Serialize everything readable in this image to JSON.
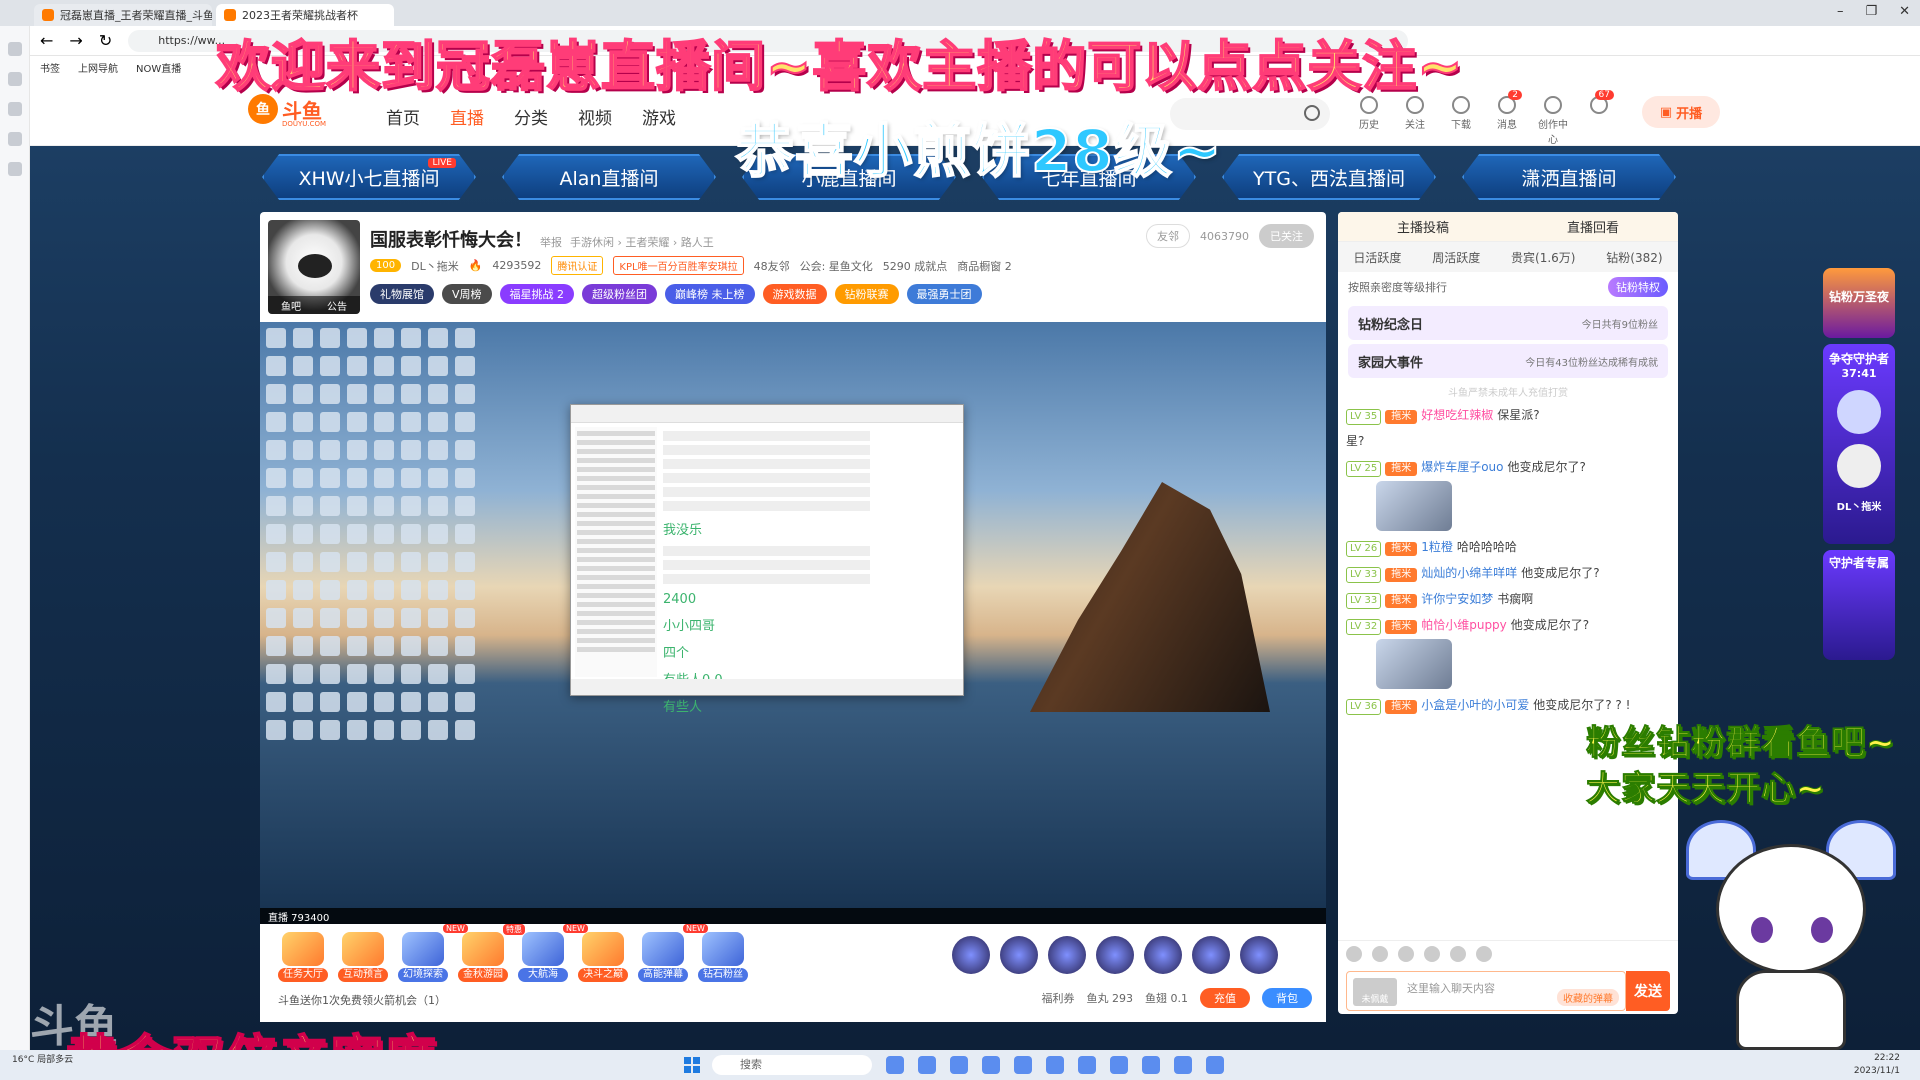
{
  "browser": {
    "tabs": [
      "冠磊崽直播_王者荣耀直播_斗鱼直...",
      "2023王者荣耀挑战者杯"
    ],
    "address": "https://ww...",
    "bookmarks": [
      "书签",
      "上网导航",
      "NOW直播"
    ]
  },
  "header": {
    "logo_text": "斗鱼",
    "logo_sub": "DOUYU.COM",
    "nav": [
      "首页",
      "直播",
      "分类",
      "视频",
      "游戏"
    ],
    "icons": [
      {
        "label": "历史",
        "badge": ""
      },
      {
        "label": "关注",
        "badge": ""
      },
      {
        "label": "下载",
        "badge": ""
      },
      {
        "label": "消息",
        "badge": "2"
      },
      {
        "label": "创作中心",
        "badge": ""
      },
      {
        "label": "",
        "badge": "67"
      }
    ],
    "broadcast_label": "开播"
  },
  "rooms": [
    "XHW小七直播间",
    "Alan直播间",
    "小鹿直播间",
    "七年直播间",
    "YTG、西法直播间",
    "潇洒直播间"
  ],
  "room_live_badge": "LIVE",
  "room_info": {
    "title": "国服表彰忏悔大会！",
    "report": "举报",
    "breadcrumb": "手游休闲 › 王者荣耀 › 路人王",
    "avatar_label_left": "鱼吧",
    "avatar_label_right": "公告",
    "level": "100",
    "streamer": "DL丶拖米",
    "heat": "4293592",
    "verify": "腾讯认证",
    "kpl": "KPL唯一百分百胜率安琪拉",
    "friends": "48友邻",
    "guild": "公会: 星鱼文化",
    "points": "5290 成就点",
    "shop": "商品橱窗 2",
    "friend_btn": "友邻",
    "fans": "4063790",
    "follow_btn": "已关注",
    "buttons": [
      {
        "label": "礼物展馆",
        "color": "#2a3b6b"
      },
      {
        "label": "V周榜",
        "color": "#4b4b4b"
      },
      {
        "label": "福星挑战 2",
        "color": "#8a3cff"
      },
      {
        "label": "超级粉丝团",
        "color": "#7a3bd8"
      },
      {
        "label": "巅峰榜 未上榜",
        "color": "#4a5ee8"
      },
      {
        "label": "游戏数据",
        "color": "#ff5d23"
      },
      {
        "label": "钻粉联赛",
        "color": "#ff9b00"
      },
      {
        "label": "最强勇士团",
        "color": "#3e7bd8"
      }
    ]
  },
  "video": {
    "inner_chat_lines": [
      "我没乐",
      "2400",
      "小小四哥",
      "四个",
      "有些人0.0",
      "有些人"
    ],
    "bar_text": "直播 793400"
  },
  "gifts": [
    {
      "label": "任务大厅",
      "new": "",
      "style": "orange"
    },
    {
      "label": "互动预言",
      "new": "",
      "style": "orange"
    },
    {
      "label": "幻境探索",
      "new": "NEW",
      "style": "blue"
    },
    {
      "label": "金秋游园",
      "new": "特惠",
      "style": "orange"
    },
    {
      "label": "大航海",
      "new": "NEW",
      "style": "blue"
    },
    {
      "label": "决斗之巅",
      "new": "",
      "style": "orange"
    },
    {
      "label": "高能弹幕",
      "new": "NEW",
      "style": "blue"
    },
    {
      "label": "钻石粉丝",
      "new": "",
      "style": "blue"
    }
  ],
  "video_tip": "斗鱼送你1次免费领火箭机会（1）",
  "video_footer": {
    "welfare": "福利券",
    "fish_ball": "鱼丸 293",
    "fish_wing": "鱼翅 0.1",
    "recharge": "充值",
    "backpack": "背包"
  },
  "chat": {
    "head": [
      "主播投稿",
      "直播回看"
    ],
    "tabs": [
      "日活跃度",
      "周活跃度",
      "贵宾(1.6万)",
      "钻粉(382)"
    ],
    "rank_text": "按照亲密度等级排行",
    "vip_btn": "钻粉特权",
    "cards": [
      {
        "title": "钻粉纪念日",
        "right": "今日共有9位粉丝"
      },
      {
        "title": "家园大事件",
        "right": "今日有43位粉丝达成稀有成就"
      }
    ],
    "warning": "斗鱼严禁未成年人充值打赏",
    "messages": [
      {
        "lv": "LV 35",
        "name": "好想吃红辣椒",
        "text": "保星派?",
        "pink": true,
        "img": false
      },
      {
        "lv": "",
        "name": "",
        "text": "星?",
        "pink": false,
        "img": false
      },
      {
        "lv": "LV 25",
        "name": "爆炸车厘子ouo",
        "text": "他变成尼尔了?",
        "pink": false,
        "img": true
      },
      {
        "lv": "LV 26",
        "name": "1粒橙",
        "text": "哈哈哈哈哈",
        "pink": false,
        "img": false
      },
      {
        "lv": "LV 33",
        "name": "灿灿的小绵羊咩咩",
        "text": "他变成尼尔了?",
        "pink": false,
        "img": false
      },
      {
        "lv": "LV 33",
        "name": "许你宁安如梦",
        "text": "书瘸啊",
        "pink": false,
        "img": false
      },
      {
        "lv": "LV 32",
        "name": "帕恰小维puppy",
        "text": "他变成尼尔了?",
        "pink": true,
        "img": true
      },
      {
        "lv": "LV 36",
        "name": "小盒是小叶的小可爱",
        "text": "他变成尼尔了? ? !",
        "pink": false,
        "img": false
      }
    ],
    "fan_badge": "拖米",
    "input_placeholder": "这里输入聊天内容",
    "not_equipped": "未佩戴",
    "collapse": "收藏的弹幕",
    "send": "发送"
  },
  "right_strip": [
    "钻粉万圣夜",
    "争夺守护者",
    "37:41",
    "DL丶拖米",
    "守护者专属"
  ],
  "taskbar": {
    "search": "搜索",
    "weather": "16°C 局部多云",
    "time": "22:22",
    "date": "2023/11/1"
  },
  "overlays": {
    "top": "欢迎来到冠磊崽直播间~喜欢主播的可以点点关注~",
    "level": "恭喜小煎饼28级~",
    "right": "粉丝钻粉群看鱼吧~\n大家天天开心~",
    "bottom": "黄金双倍亲密度~",
    "watermark": "斗鱼"
  }
}
